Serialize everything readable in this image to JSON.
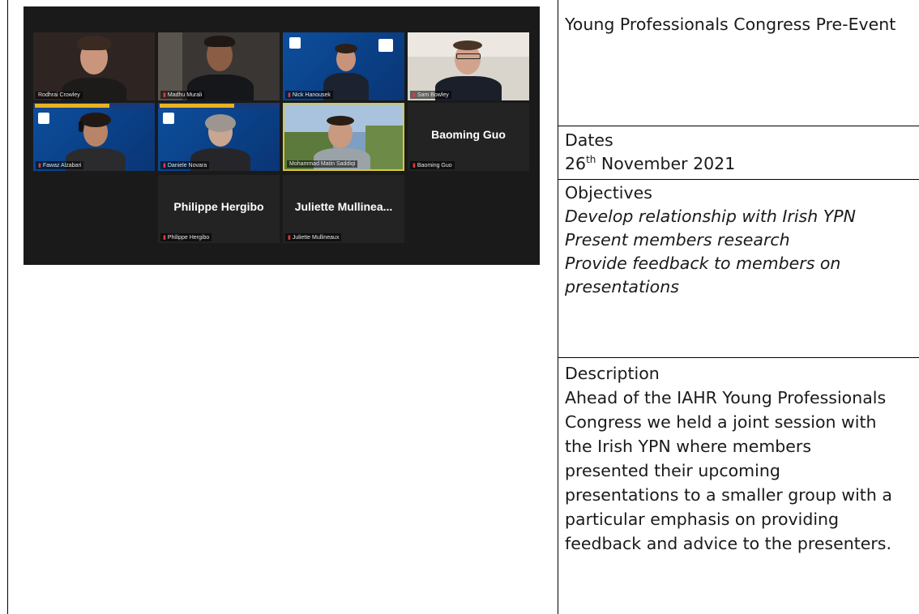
{
  "meeting": {
    "participants": [
      {
        "name": "Rodhrai Crowley"
      },
      {
        "name": "Madhu Murali"
      },
      {
        "name": "Nick Hanousek"
      },
      {
        "name": "Sam Bowley"
      },
      {
        "name": "Fawaz Alzabari"
      },
      {
        "name": "Daniele Novara"
      },
      {
        "name": "Mohammad Matin Saddiqi"
      },
      {
        "name": "Baoming Guo",
        "display": "Baoming Guo"
      },
      {
        "name": "Philippe Hergibo",
        "display": "Philippe Hergibo"
      },
      {
        "name": "Juliette Mullineaux",
        "display": "Juliette  Mullinea..."
      }
    ]
  },
  "table": {
    "title": "Young Professionals Congress Pre-Event",
    "dates": {
      "heading": "Dates",
      "day": "26",
      "suffix": "th",
      "rest": " November 2021"
    },
    "objectives": {
      "heading": "Objectives",
      "items": [
        "Develop relationship with Irish YPN",
        "Present members research",
        "Provide feedback to members on presentations"
      ]
    },
    "description": {
      "heading": "Description",
      "text": "Ahead of the IAHR Young Professionals Congress we held a joint session with the Irish YPN where members presented their upcoming presentations to a smaller group with a particular emphasis on providing feedback and advice to the presenters."
    }
  }
}
